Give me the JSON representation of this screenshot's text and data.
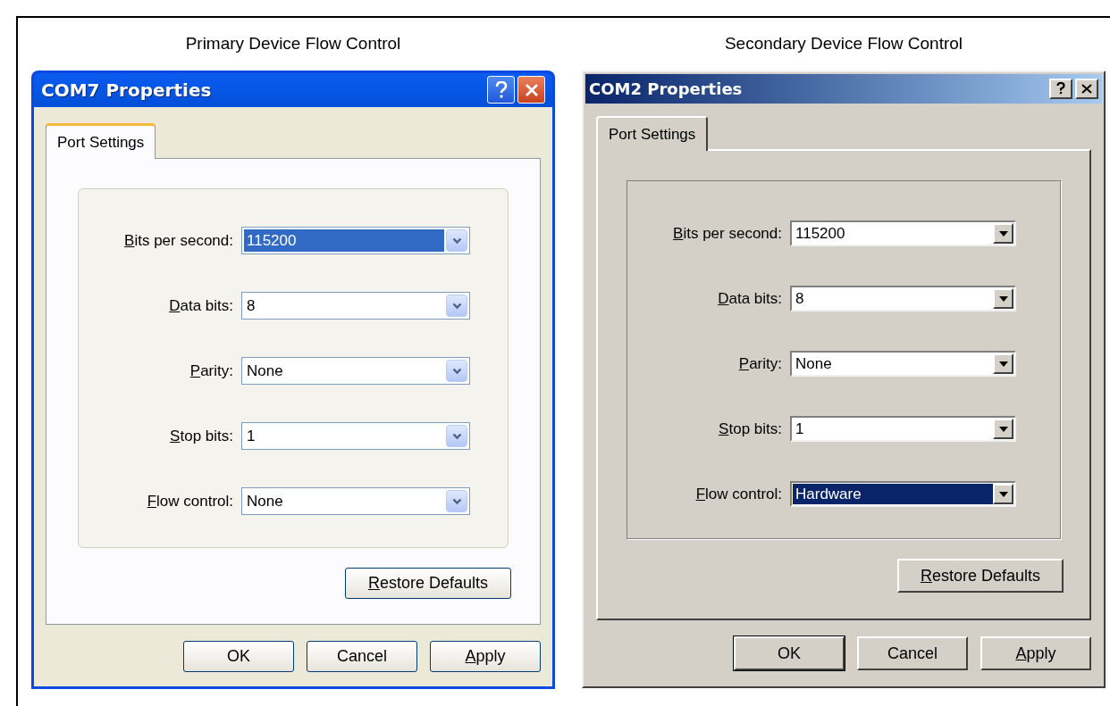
{
  "panels": [
    {
      "heading": "Primary Device Flow Control",
      "dialog": {
        "kind": "xp",
        "title": "COM7 Properties",
        "tabs": [
          {
            "label": "Port Settings",
            "selected": true
          }
        ],
        "fields": [
          {
            "label": "Bits per second:",
            "underline_first": true,
            "value": "115200",
            "focused": true
          },
          {
            "label": "Data bits:",
            "underline_first": true,
            "value": "8",
            "focused": false
          },
          {
            "label": "Parity:",
            "underline_first": true,
            "value": "None",
            "focused": false
          },
          {
            "label": "Stop bits:",
            "underline_first": true,
            "value": "1",
            "focused": false
          },
          {
            "label": "Flow control:",
            "underline_first": true,
            "value": "None",
            "focused": false
          }
        ],
        "restore_button": {
          "label": "Restore Defaults",
          "underline_first": true
        },
        "buttons": [
          {
            "label": "OK",
            "underline_first": false
          },
          {
            "label": "Cancel",
            "underline_first": false
          },
          {
            "label": "Apply",
            "underline_first": true
          }
        ]
      }
    },
    {
      "heading": "Secondary Device Flow Control",
      "dialog": {
        "kind": "classic",
        "title": "COM2 Properties",
        "tabs": [
          {
            "label": "Port Settings",
            "selected": true
          }
        ],
        "fields": [
          {
            "label": "Bits per second:",
            "underline_first": true,
            "value": "115200",
            "focused": false
          },
          {
            "label": "Data bits:",
            "underline_first": true,
            "value": "8",
            "focused": false
          },
          {
            "label": "Parity:",
            "underline_first": true,
            "value": "None",
            "focused": false
          },
          {
            "label": "Stop bits:",
            "underline_first": true,
            "value": "1",
            "focused": false
          },
          {
            "label": "Flow control:",
            "underline_first": true,
            "value": "Hardware",
            "focused": true
          }
        ],
        "restore_button": {
          "label": "Restore Defaults",
          "underline_first": true
        },
        "buttons": [
          {
            "label": "OK",
            "underline_first": false
          },
          {
            "label": "Cancel",
            "underline_first": false
          },
          {
            "label": "Apply",
            "underline_first": true
          }
        ]
      }
    }
  ]
}
